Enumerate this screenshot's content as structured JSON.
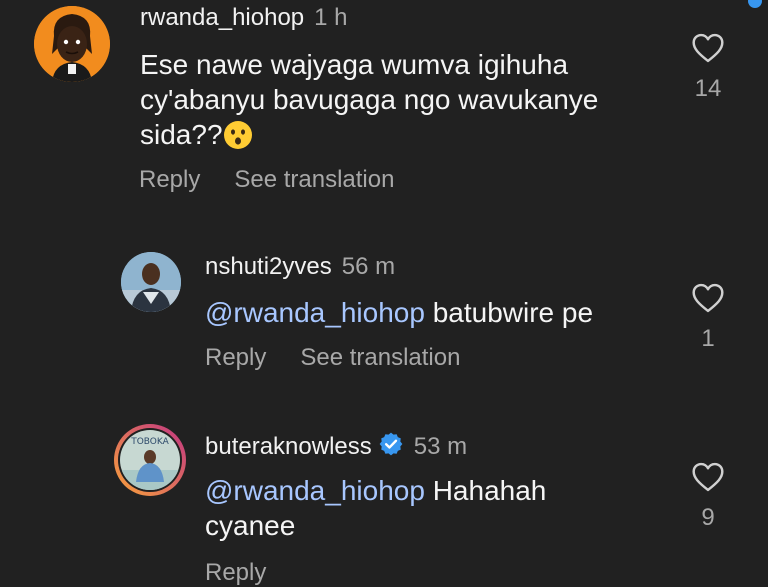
{
  "comments": [
    {
      "username": "rwanda_hiohop",
      "time": "1 h",
      "text_lines": [
        "Ese nawe wajyaga wumva igihuha",
        "cy'abanyu bavugaga ngo wavukanye",
        "sida??"
      ],
      "emoji": "hushed-face-emoji",
      "likes": "14",
      "reply_label": "Reply",
      "translate_label": "See translation"
    },
    {
      "username": "nshuti2yves",
      "time": "56 m",
      "mention": "@rwanda_hiohop",
      "text": "batubwire pe",
      "likes": "1",
      "reply_label": "Reply",
      "translate_label": "See translation"
    },
    {
      "username": "buteraknowless",
      "time": "53 m",
      "verified": true,
      "mention": "@rwanda_hiohop",
      "text_line1": "Hahahah",
      "text_line2": "cyanee",
      "likes": "9",
      "reply_label": "Reply",
      "avatar_story_text": "TOBOKA"
    }
  ],
  "colors": {
    "background": "#212121",
    "mention": "#a8c7ff",
    "verified_badge": "#3897f0",
    "muted": "#a8a8a8",
    "story_ring_start": "#f9a33a",
    "story_ring_end": "#c13584"
  },
  "icons": [
    "heart-outline-icon",
    "verified-badge-icon",
    "hushed-face-emoji"
  ]
}
